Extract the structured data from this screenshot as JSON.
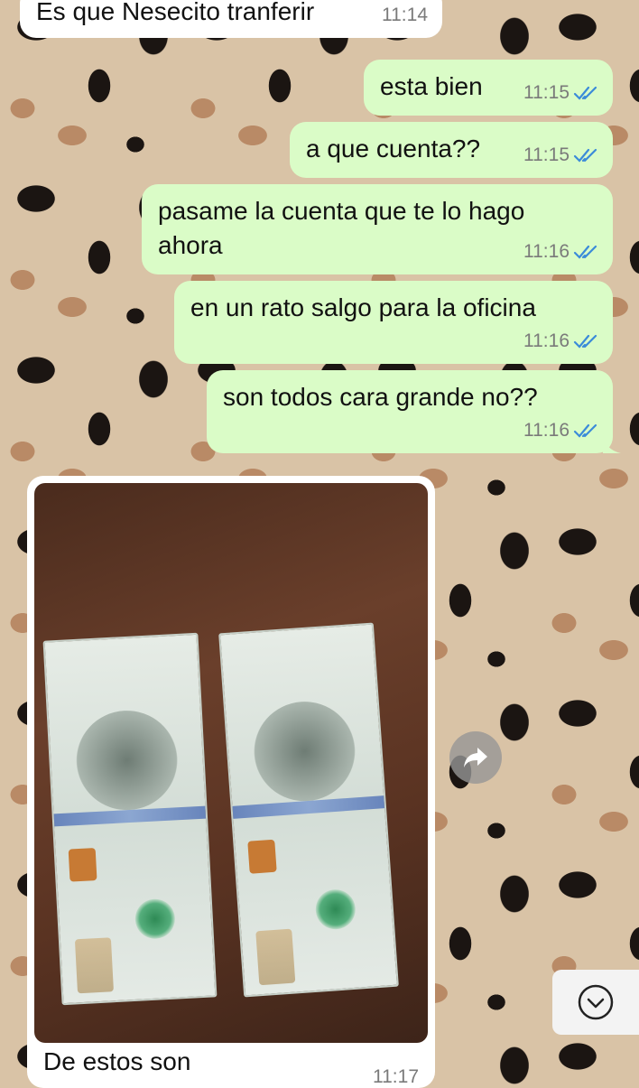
{
  "messages": {
    "incoming_top": {
      "text": "Es que Nesecito tranferir",
      "time": "11:14"
    },
    "out_1": {
      "text": "esta bien",
      "time": "11:15"
    },
    "out_2": {
      "text": "a que cuenta??",
      "time": "11:15"
    },
    "out_3": {
      "text": "pasame la cuenta que te lo hago ahora",
      "time": "11:16"
    },
    "out_4": {
      "text": "en un rato salgo para la oficina",
      "time": "11:16"
    },
    "out_5": {
      "text": "son todos cara grande no??",
      "time": "11:16"
    },
    "photo_message": {
      "caption": "De estos son",
      "time": "11:17"
    }
  },
  "icons": {
    "read_receipt": "double-check-icon",
    "forward": "forward-arrow-icon",
    "scroll_down": "chevron-down-circle-icon"
  },
  "colors": {
    "outgoing_bubble": "#dafcc7",
    "incoming_bubble": "#ffffff",
    "read_tick": "#3b8bd9",
    "timestamp": "#7a7a7a"
  }
}
